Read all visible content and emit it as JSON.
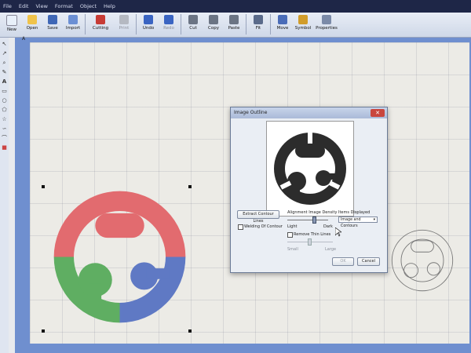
{
  "menu": [
    "File",
    "Edit",
    "View",
    "Format",
    "Object",
    "Help"
  ],
  "toolbar": [
    {
      "label": "New",
      "color": "#e8f0fa"
    },
    {
      "label": "Open",
      "color": "#f0c34a"
    },
    {
      "label": "Save",
      "color": "#3f67b6"
    },
    {
      "label": "Import",
      "color": "#6b8fd4"
    },
    {
      "label": "Cutting",
      "color": "#c73b35"
    },
    {
      "label": "Print",
      "color": "#b5b9c2",
      "disabled": true
    },
    {
      "label": "Undo",
      "color": "#3a64c2"
    },
    {
      "label": "Redo",
      "color": "#3a64c2"
    },
    {
      "label": "Cut",
      "color": "#6b7484"
    },
    {
      "label": "Copy",
      "color": "#6b7484"
    },
    {
      "label": "Paste",
      "color": "#6b7484"
    },
    {
      "label": "Fit",
      "color": "#5a6a8a"
    },
    {
      "label": "Move",
      "color": "#4a6cb8"
    },
    {
      "label": "Symbol",
      "color": "#d19c2a"
    },
    {
      "label": "Properties",
      "color": "#7b8aa8"
    }
  ],
  "document": {
    "tab": "A"
  },
  "dialog": {
    "title": "Image Outline",
    "close": "✕",
    "extract_button": "Extract Contour Lines",
    "welding_label": "Welding Of Contour",
    "density_label": "Alignment Image Density",
    "light_label": "Light",
    "dark_label": "Dark",
    "items_label": "Items Displayed",
    "items_value": "Image and Contours",
    "remove_label": "Remove Thin Lines",
    "small_label": "Small",
    "large_label": "Large",
    "ok_label": "OK",
    "cancel_label": "Cancel"
  },
  "colors": {
    "red": "#e26b6f",
    "green": "#5fae62",
    "blue": "#5f79c4",
    "dark": "#2c2c2c"
  }
}
